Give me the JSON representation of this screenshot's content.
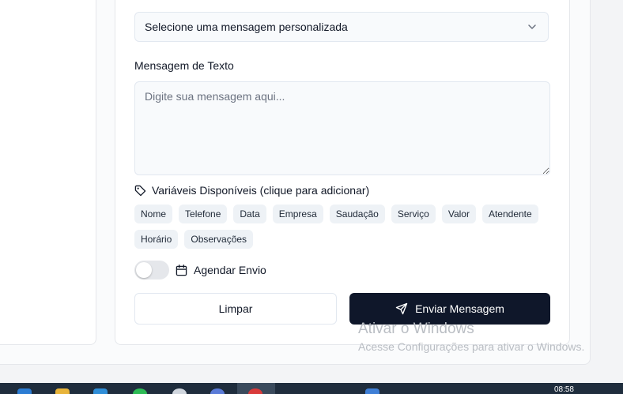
{
  "form": {
    "custom_message_select": {
      "value": "Selecione uma mensagem personalizada"
    },
    "text_message": {
      "label": "Mensagem de Texto",
      "placeholder": "Digite sua mensagem aqui...",
      "value": ""
    },
    "variables": {
      "title": "Variáveis Disponíveis (clique para adicionar)",
      "chips": [
        "Nome",
        "Telefone",
        "Data",
        "Empresa",
        "Saudação",
        "Serviço",
        "Valor",
        "Atendente",
        "Horário",
        "Observações"
      ]
    },
    "schedule": {
      "label": "Agendar Envio",
      "enabled": false
    },
    "buttons": {
      "clear_label": "Limpar",
      "send_label": "Enviar Mensagem"
    }
  },
  "windows_watermark": {
    "title": "Ativar o Windows",
    "subtitle": "Acesse Configurações para ativar o Windows."
  },
  "taskbar": {
    "time": "08:58"
  },
  "colors": {
    "primary_button": "#0f172a",
    "input_background": "#f8fafc",
    "chip_background": "#eef2f6"
  }
}
